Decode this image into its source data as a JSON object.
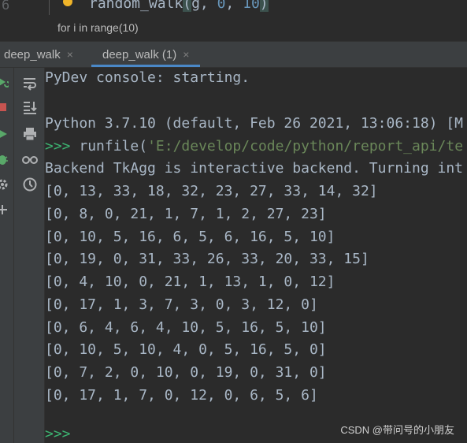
{
  "editor": {
    "line_number": "6",
    "code_fn": "random_walk",
    "code_args_open": "(",
    "code_arg1": "g, ",
    "code_arg2": "0",
    "code_sep": ", ",
    "code_arg3": "10",
    "code_args_close": ")",
    "breadcrumb": "for i in range(10)"
  },
  "tabs": [
    {
      "label": "deep_walk",
      "close": "×"
    },
    {
      "label": "deep_walk (1)",
      "close": "×"
    }
  ],
  "console": {
    "lines": [
      "PyDev console: starting.",
      "",
      "Python 3.7.10 (default, Feb 26 2021, 13:06:18) [M",
      "runfile('E:/develop/code/python/report_api/te",
      "Backend TkAgg is interactive backend. Turning int",
      "[0, 13, 33, 18, 32, 23, 27, 33, 14, 32]",
      "[0, 8, 0, 21, 1, 7, 1, 2, 27, 23]",
      "[0, 10, 5, 16, 6, 5, 6, 16, 5, 10]",
      "[0, 19, 0, 31, 33, 26, 33, 20, 33, 15]",
      "[0, 4, 10, 0, 21, 1, 13, 1, 0, 12]",
      "[0, 17, 1, 3, 7, 3, 0, 3, 12, 0]",
      "[0, 6, 4, 6, 4, 10, 5, 16, 5, 10]",
      "[0, 10, 5, 10, 4, 0, 5, 16, 5, 0]",
      "[0, 7, 2, 0, 10, 0, 19, 0, 31, 0]",
      "[0, 17, 1, 7, 0, 12, 0, 6, 5, 6]"
    ],
    "prompt": ">>>",
    "runfile_fn": "runfile(",
    "runfile_str": "'E:/develop/code/python/report_api/te",
    "end_prompt": ">>>"
  },
  "watermark": "CSDN @带问号的小朋友",
  "icons": {
    "rerun": "rerun-icon",
    "stop": "stop-icon",
    "run": "run-icon",
    "debug": "debug-icon",
    "settings": "settings-icon",
    "add": "plus-icon",
    "wrap": "soft-wrap-icon",
    "scroll_end": "scroll-to-end-icon",
    "print": "print-icon",
    "variables": "show-variables-icon",
    "history": "history-icon"
  },
  "colors": {
    "background": "#2b2b2b",
    "panel": "#3c3f41",
    "prompt": "#3cb371",
    "string": "#6a8759",
    "number": "#6897bb",
    "text": "#a9b7c6",
    "tab_underline": "#4a88c7"
  }
}
